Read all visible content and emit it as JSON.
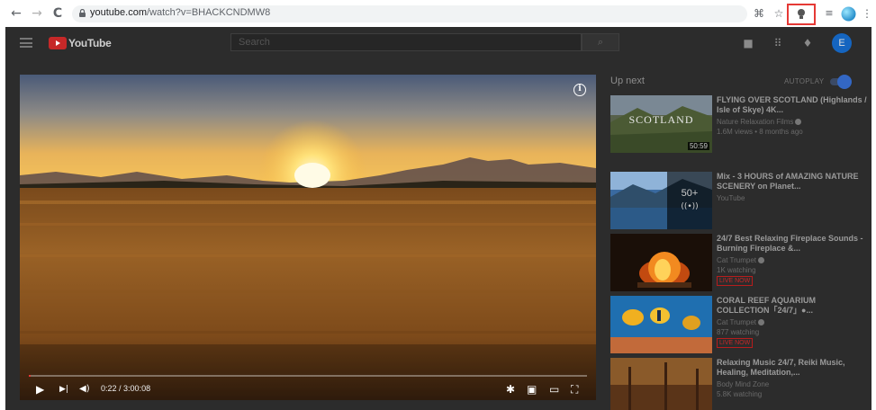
{
  "browser": {
    "url_host": "youtube.com",
    "url_path": "/watch?v=BHACKCNDMW8",
    "back_icon": "←",
    "forward_icon": "→",
    "reload_icon": "C",
    "translate_icon": "⌘",
    "star_icon": "☆",
    "extension_icon": "●",
    "media_icon": "≡",
    "menu_icon": "⋮"
  },
  "youtube": {
    "logo_text": "YouTube",
    "search_placeholder": "Search",
    "search_icon": "⌕",
    "create_icon": "■",
    "apps_icon": "⠿",
    "bell_icon": "♦",
    "avatar_letter": "E"
  },
  "player": {
    "info_label": "i",
    "current_time": "0:22",
    "separator": " / ",
    "duration": "3:00:08",
    "progress_fraction": 0.002,
    "play_icon": "▶",
    "next_icon": "▶|",
    "volume_icon": "◀)",
    "settings_icon": "✱",
    "miniplayer_icon": "▣",
    "theater_icon": "▭",
    "fullscreen_icon": "⛶"
  },
  "upnext": {
    "title": "Up next",
    "autoplay_label": "AUTOPLAY",
    "autoplay_on": true
  },
  "recommendations": [
    {
      "title": "FLYING OVER SCOTLAND (Highlands / Isle of Skye) 4K...",
      "channel": "Nature Relaxation Films",
      "meta": "1.6M views • 8 months ago",
      "duration": "50:59",
      "thumb_text": "SCOTLAND"
    },
    {
      "title": "Mix - 3 HOURS of AMAZING NATURE SCENERY on Planet...",
      "channel": "YouTube",
      "mix_count": "50+",
      "mix_icon": "((•))"
    },
    {
      "title": "24/7 Best Relaxing Fireplace Sounds - Burning Fireplace &...",
      "channel": "Cat Trumpet",
      "meta": "1K watching",
      "live": "LIVE NOW"
    },
    {
      "title": "CORAL REEF AQUARIUM COLLECTION「24/7」●...",
      "channel": "Cat Trumpet",
      "meta": "877 watching",
      "live": "LIVE NOW"
    },
    {
      "title": "Relaxing Music 24/7, Reiki Music, Healing, Meditation,...",
      "channel": "Body Mind Zone",
      "meta": "5.8K watching"
    }
  ]
}
